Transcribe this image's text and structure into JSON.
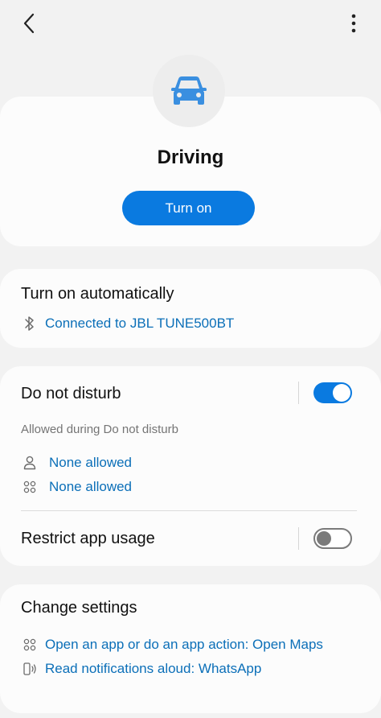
{
  "hero": {
    "title": "Driving",
    "turn_on_label": "Turn on"
  },
  "auto": {
    "title": "Turn on automatically",
    "connection_text": "Connected to JBL TUNE500BT"
  },
  "dnd": {
    "title": "Do not disturb",
    "enabled": true,
    "allowed_label": "Allowed during Do not disturb",
    "people_text": "None allowed",
    "apps_text": "None allowed"
  },
  "restrict": {
    "title": "Restrict app usage",
    "enabled": false
  },
  "change": {
    "title": "Change settings",
    "open_app_text": "Open an app or do an app action: Open Maps",
    "read_notifications_text": "Read notifications aloud: WhatsApp"
  },
  "colors": {
    "accent": "#0a7ae0",
    "link": "#0b6fb8",
    "icon_blue": "#3a8fe0"
  },
  "icons": {
    "back": "chevron-left-icon",
    "more": "more-vertical-icon",
    "mode": "car-icon",
    "bluetooth": "bluetooth-icon",
    "person": "person-icon",
    "apps": "apps-grid-icon",
    "speaker": "phone-speaker-icon"
  }
}
